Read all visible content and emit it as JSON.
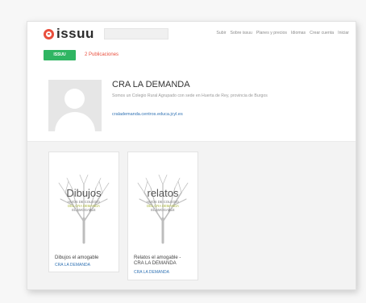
{
  "header": {
    "logo_text": "issuu",
    "search_placeholder": "",
    "nav": [
      "Subir",
      "Sobre issuu",
      "Planes y precios",
      "Idiomas",
      "Crear cuenta",
      "Iniciar"
    ]
  },
  "actions": {
    "issuu_button": "ISSUU",
    "publications_count": "2 Publicaciones"
  },
  "profile": {
    "name": "CRA LA DEMANDA",
    "description": "Somos un Colegio Rural Agrupado con sede en Huerta de Rey, provincia de Burgos",
    "website": "cralademanda.centros.educa.jcyl.es"
  },
  "publications": [
    {
      "title": "Dibujos el amogable",
      "author": "CRA LA DEMANDA",
      "cover_word": "Dibujos",
      "cover_tagline": [
        "HIJOS DE COLEGIO",
        "DEL CRA DEMANDA",
        "EL AMOGABLE"
      ]
    },
    {
      "title": "Relatos el amogable - CRA LA DEMANDA",
      "author": "CRA LA DEMANDA",
      "cover_word": "relatos",
      "cover_tagline": [
        "HIJOS DE COLEGIO",
        "DEL CRA DEMANDA",
        "EL AMOGABLE"
      ]
    }
  ],
  "colors": {
    "brand": "#e94e3c",
    "issuu_button": "#2fb562",
    "link": "#3173b4",
    "cover_accent": "#a8b43a"
  }
}
